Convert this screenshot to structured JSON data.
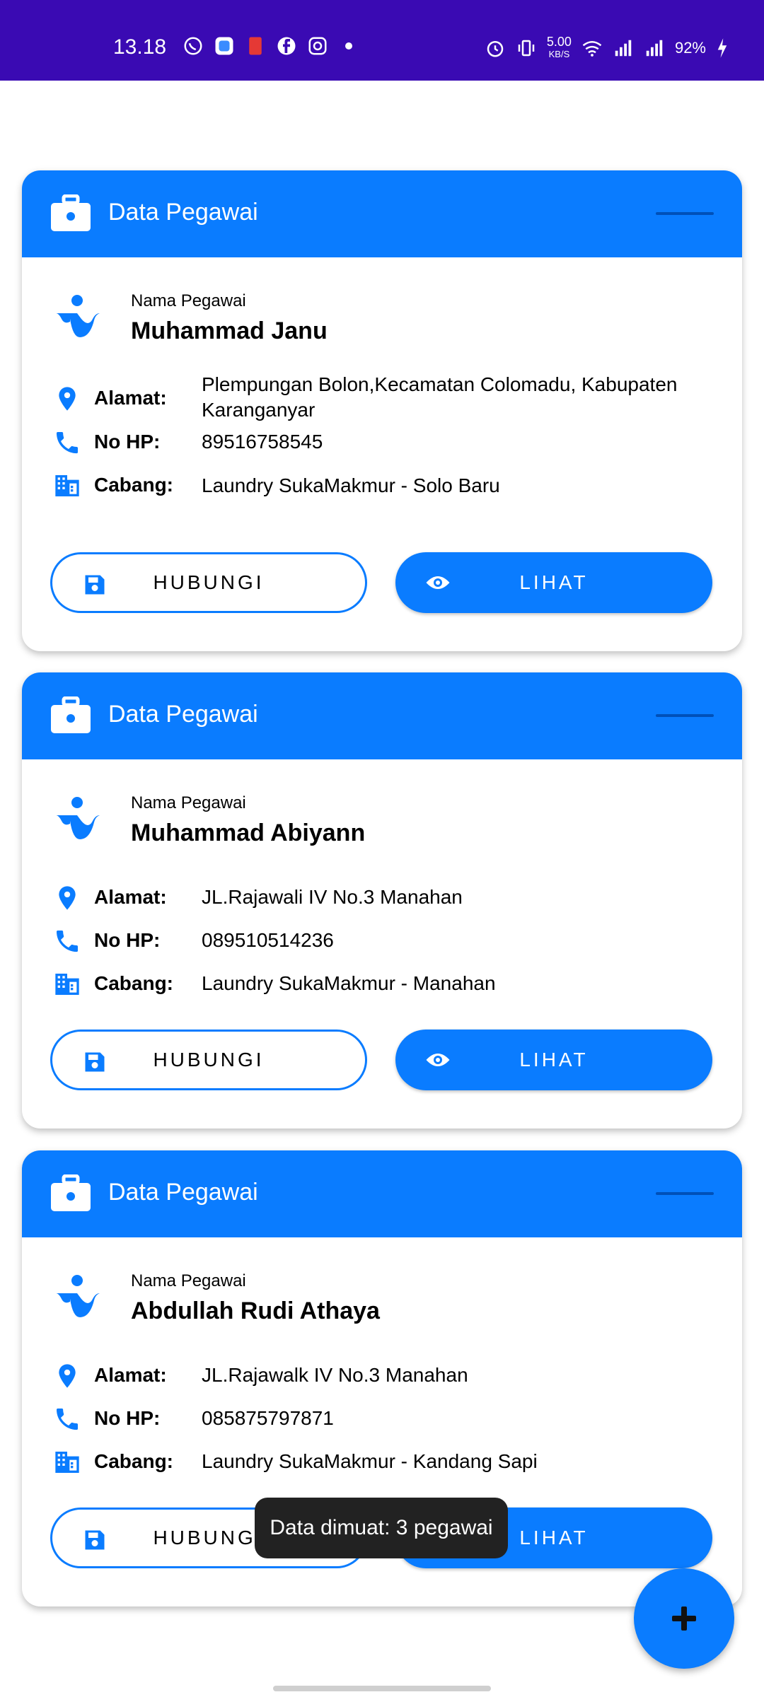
{
  "status_bar": {
    "time": "13.18",
    "speed_value": "5.00",
    "speed_unit": "KB/S",
    "battery": "92%"
  },
  "cards": [
    {
      "header_title": "Data Pegawai",
      "name_label": "Nama Pegawai",
      "name": "Muhammad Janu",
      "address_label": "Alamat:",
      "address": "Plempungan Bolon,Kecamatan Colomadu, Kabupaten Karanganyar",
      "phone_label": "No HP:",
      "phone": "89516758545",
      "branch_label": "Cabang:",
      "branch": "Laundry SukaMakmur - Solo Baru",
      "contact_label": "HUBUNGI",
      "view_label": "LIHAT"
    },
    {
      "header_title": "Data Pegawai",
      "name_label": "Nama Pegawai",
      "name": "Muhammad Abiyann",
      "address_label": "Alamat:",
      "address": "JL.Rajawali IV No.3 Manahan",
      "phone_label": "No HP:",
      "phone": "089510514236",
      "branch_label": "Cabang:",
      "branch": "Laundry SukaMakmur - Manahan",
      "contact_label": "HUBUNGI",
      "view_label": "LIHAT"
    },
    {
      "header_title": "Data Pegawai",
      "name_label": "Nama Pegawai",
      "name": "Abdullah Rudi Athaya",
      "address_label": "Alamat:",
      "address": "JL.Rajawalk IV No.3 Manahan",
      "phone_label": "No HP:",
      "phone": "085875797871",
      "branch_label": "Cabang:",
      "branch": "Laundry SukaMakmur - Kandang Sapi",
      "contact_label": "HUBUNGI",
      "view_label": "LIHAT"
    }
  ],
  "toast": "Data dimuat: 3 pegawai",
  "fab_icon": "plus-icon",
  "colors": {
    "status_bar": "#3a0ab3",
    "primary": "#0a7cff"
  }
}
